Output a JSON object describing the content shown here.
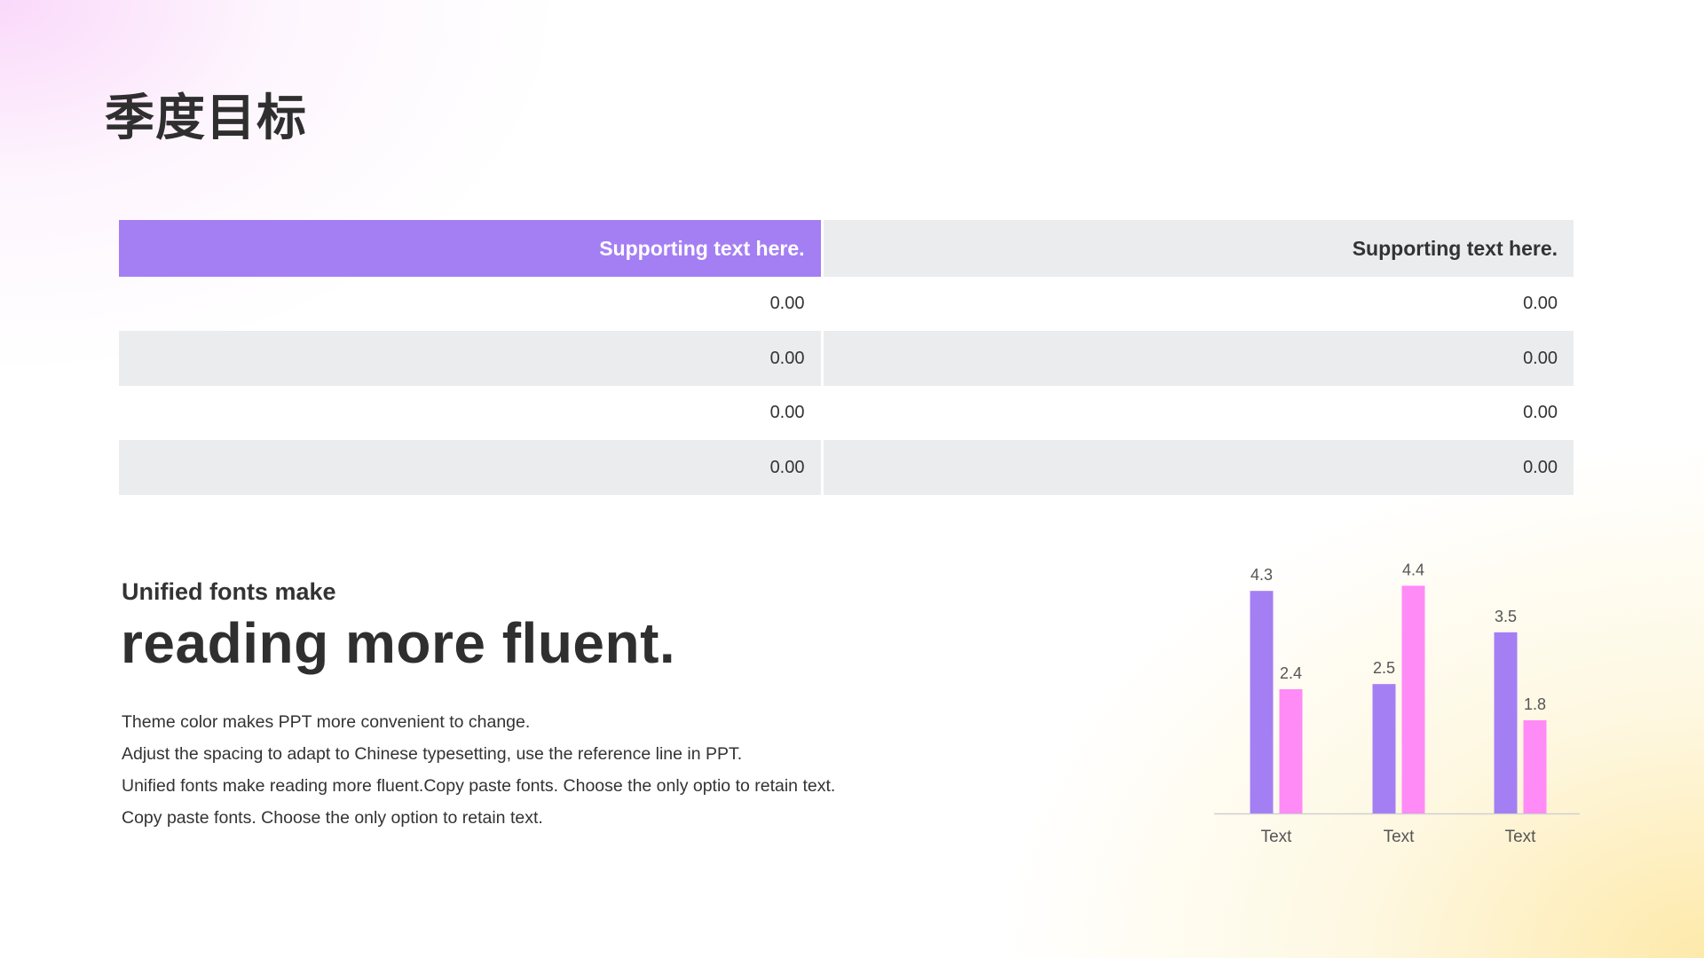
{
  "page": {
    "title": "季度目标"
  },
  "colors": {
    "accent_purple": "#A47FF4",
    "accent_pink": "#FF8BF6",
    "table_gray": "#EBECEE",
    "text_dark": "#333333",
    "axis_gray": "#D0D0D0"
  },
  "table": {
    "headers": [
      "Supporting text here.",
      "Supporting text here."
    ],
    "rows": [
      [
        "0.00",
        "0.00"
      ],
      [
        "0.00",
        "0.00"
      ],
      [
        "0.00",
        "0.00"
      ],
      [
        "0.00",
        "0.00"
      ]
    ]
  },
  "text_block": {
    "subtitle": "Unified fonts make",
    "headline": "reading more fluent.",
    "lines": [
      "Theme  color makes  PPT more convenient  to change.",
      "Adjust  the spacing  to adapt to Chinese  typesetting,  use  the reference line  in  PPT.",
      "Unified  fonts make reading more fluent.Copy paste fonts. Choose the only optio to retain text.",
      "Copy paste  fonts. Choose the only option to retain text."
    ]
  },
  "chart_data": {
    "type": "bar",
    "categories": [
      "Text",
      "Text",
      "Text"
    ],
    "series": [
      {
        "values": [
          4.3,
          2.5,
          3.5
        ],
        "color": "#A47FF4"
      },
      {
        "values": [
          2.4,
          4.4,
          1.8
        ],
        "color": "#FF8BF6"
      }
    ],
    "data_labels": true,
    "grid": false,
    "legend": "none",
    "ylim": [
      0,
      4.8
    ]
  }
}
